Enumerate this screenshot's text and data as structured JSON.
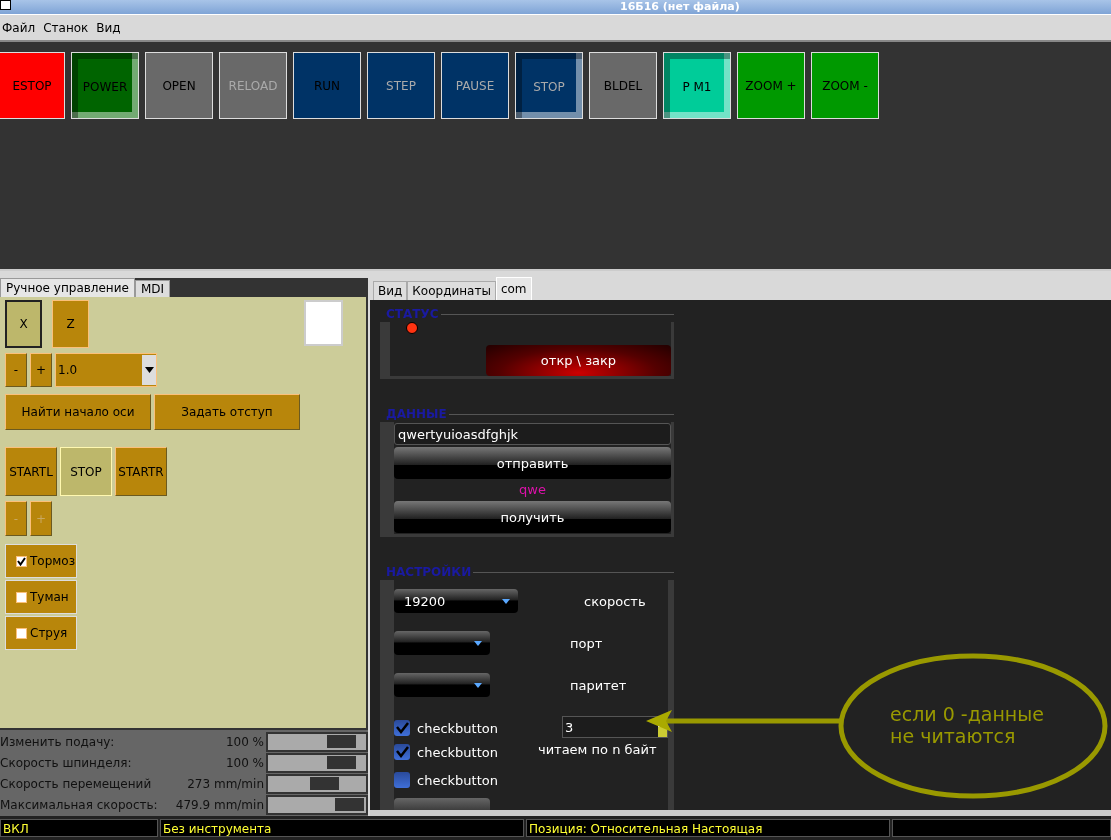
{
  "window": {
    "title": "16Б16 (нет файла)"
  },
  "menu": [
    "Файл",
    "Станок",
    "Вид"
  ],
  "toolbar": [
    {
      "label": "ESTOP",
      "color": "#ff0000",
      "pressed": false,
      "disabled": false
    },
    {
      "label": "POWER",
      "color": "#006400",
      "pressed": true,
      "disabled": false
    },
    {
      "label": "OPEN",
      "color": "#696969",
      "pressed": false,
      "disabled": false
    },
    {
      "label": "RELOAD",
      "color": "#696969",
      "pressed": false,
      "disabled": true
    },
    {
      "label": "RUN",
      "color": "#003366",
      "pressed": false,
      "disabled": false
    },
    {
      "label": "STEP",
      "color": "#003366",
      "pressed": false,
      "disabled": true
    },
    {
      "label": "PAUSE",
      "color": "#003366",
      "pressed": false,
      "disabled": true
    },
    {
      "label": "STOP",
      "color": "#003366",
      "pressed": true,
      "disabled": true
    },
    {
      "label": "BLDEL",
      "color": "#696969",
      "pressed": false,
      "disabled": false
    },
    {
      "label": "P M1",
      "color": "#00cc99",
      "pressed": true,
      "disabled": false
    },
    {
      "label": "ZOOM +",
      "color": "#009900",
      "pressed": false,
      "disabled": false
    },
    {
      "label": "ZOOM -",
      "color": "#009900",
      "pressed": false,
      "disabled": false
    }
  ],
  "left_tabs": [
    {
      "label": "Ручное управление",
      "selected": true
    },
    {
      "label": "MDI",
      "selected": false
    }
  ],
  "axes": [
    {
      "label": "X",
      "selected": true
    },
    {
      "label": "Z",
      "selected": false
    }
  ],
  "jog": {
    "minus": "-",
    "plus": "+",
    "increment": "1.0"
  },
  "axis_buttons": [
    "Найти начало оси",
    "Задать отступ"
  ],
  "spindle": [
    {
      "label": "STARTL",
      "selected": false
    },
    {
      "label": "STOP",
      "selected": true
    },
    {
      "label": "STARTR",
      "selected": false
    }
  ],
  "spindle_speed": {
    "minus": "-",
    "plus": "+",
    "disabled": true
  },
  "coolant": [
    {
      "label": "Тормоз",
      "checked": true
    },
    {
      "label": "Туман",
      "checked": false
    },
    {
      "label": "Струя",
      "checked": false
    }
  ],
  "overrides": [
    {
      "label": "Изменить подачу:",
      "reading": "100 %",
      "level": 0.9
    },
    {
      "label": "Скорость шпинделя:",
      "reading": "100 %",
      "level": 0.9
    },
    {
      "label": "Скорость перемещений",
      "reading": "273 mm/min",
      "level": 0.72
    },
    {
      "label": "Максимальная скорость:",
      "reading": "479.9 mm/min",
      "level": 0.98
    }
  ],
  "right_tabs": [
    {
      "label": "Вид",
      "selected": false
    },
    {
      "label": "Координаты",
      "selected": false
    },
    {
      "label": "com",
      "selected": true
    }
  ],
  "status_frame": {
    "title": "СТАТУС",
    "button": "откр \\ закр"
  },
  "data_frame": {
    "title": "ДАННЫЕ",
    "input": "qwertyuioasdfghjk",
    "send": "отправить",
    "received": "qwe",
    "receive": "получить"
  },
  "settings_frame": {
    "title": "НАСТРОЙКИ",
    "combos": [
      {
        "value": "19200",
        "label": "скорость"
      },
      {
        "label": "порт"
      },
      {
        "label": "паритет"
      }
    ],
    "checks": [
      {
        "label": "checkbutton",
        "checked": true
      },
      {
        "label": "checkbutton",
        "checked": true
      },
      {
        "label": "checkbutton",
        "checked": false
      }
    ],
    "spin_value": "3",
    "spin_label": "читаем по n байт"
  },
  "annotation": {
    "text": "если 0 -данные\nне читаются"
  },
  "status_bar": [
    "ВКЛ",
    "Без инструмента",
    "Позиция: Относительная Настоящая"
  ]
}
